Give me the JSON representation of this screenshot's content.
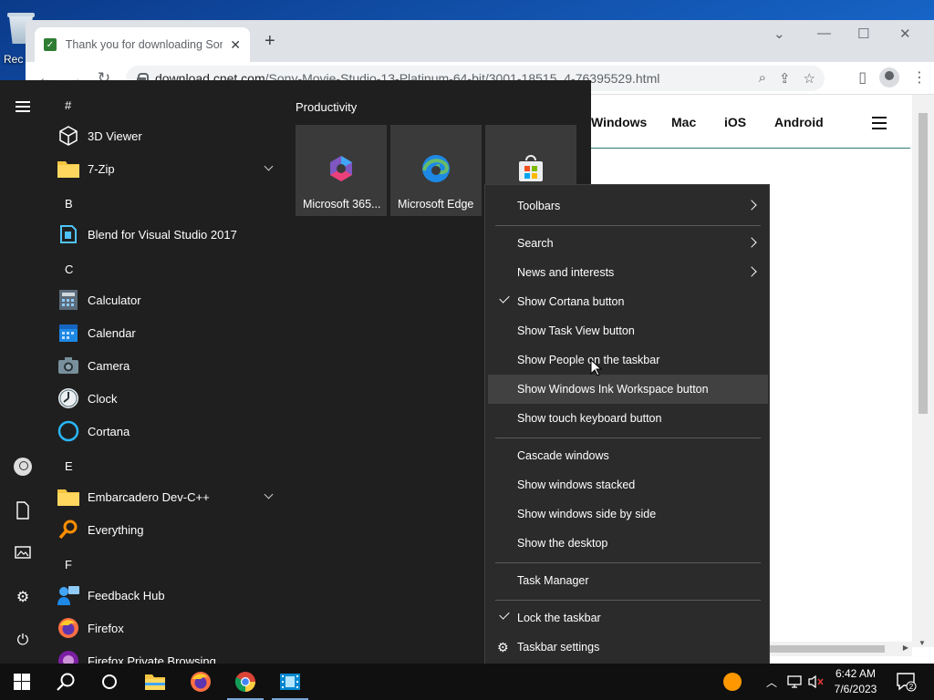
{
  "desktop": {
    "recycle_bin_label": "Rec"
  },
  "browser": {
    "tab_title": "Thank you for downloading Sony",
    "tab_favicon": "✓",
    "url_domain": "download.cnet.com",
    "url_path": "/Sony-Movie-Studio-13-Platinum-64-bit/3001-18515_4-76395529.html",
    "site_nav": [
      "Windows",
      "Mac",
      "iOS",
      "Android"
    ]
  },
  "start_menu": {
    "letters": [
      "#",
      "B",
      "C",
      "E",
      "F"
    ],
    "apps": [
      {
        "label": "3D Viewer",
        "icon": "cube-icon"
      },
      {
        "label": "7-Zip",
        "icon": "folder-icon",
        "expandable": true
      },
      {
        "label": "Blend for Visual Studio 2017",
        "icon": "blend-icon"
      },
      {
        "label": "Calculator",
        "icon": "calculator-icon"
      },
      {
        "label": "Calendar",
        "icon": "calendar-icon"
      },
      {
        "label": "Camera",
        "icon": "camera-icon"
      },
      {
        "label": "Clock",
        "icon": "clock-icon"
      },
      {
        "label": "Cortana",
        "icon": "cortana-icon"
      },
      {
        "label": "Embarcadero Dev-C++",
        "icon": "folder-icon",
        "expandable": true
      },
      {
        "label": "Everything",
        "icon": "search-icon"
      },
      {
        "label": "Feedback Hub",
        "icon": "feedback-icon"
      },
      {
        "label": "Firefox",
        "icon": "firefox-icon"
      },
      {
        "label": "Firefox Private Browsing",
        "icon": "firefox-private-icon"
      }
    ],
    "tiles_group": "Productivity",
    "tiles": [
      {
        "label": "Microsoft 365...",
        "icon": "m365-icon"
      },
      {
        "label": "Microsoft Edge",
        "icon": "edge-icon"
      },
      {
        "label": "",
        "icon": "store-icon"
      }
    ]
  },
  "context_menu": {
    "items": [
      {
        "label": "Toolbars",
        "submenu": true
      },
      {
        "label": "Search",
        "submenu": true
      },
      {
        "label": "News and interests",
        "submenu": true
      },
      {
        "label": "Show Cortana button",
        "checked": true
      },
      {
        "label": "Show Task View button"
      },
      {
        "label": "Show People on the taskbar"
      },
      {
        "label": "Show Windows Ink Workspace button",
        "hovered": true
      },
      {
        "label": "Show touch keyboard button"
      },
      {
        "label": "Cascade windows"
      },
      {
        "label": "Show windows stacked"
      },
      {
        "label": "Show windows side by side"
      },
      {
        "label": "Show the desktop"
      },
      {
        "label": "Task Manager"
      },
      {
        "label": "Lock the taskbar",
        "checked": true
      },
      {
        "label": "Taskbar settings",
        "icon": "gear-icon"
      }
    ]
  },
  "taskbar": {
    "time": "6:42 AM",
    "date": "7/6/2023",
    "notification_count": "2"
  },
  "colors": {
    "menu_bg": "#2b2b2b",
    "menu_hover": "#414141",
    "start_bg": "#1f1f1f",
    "taskbar_bg": "#101010"
  }
}
